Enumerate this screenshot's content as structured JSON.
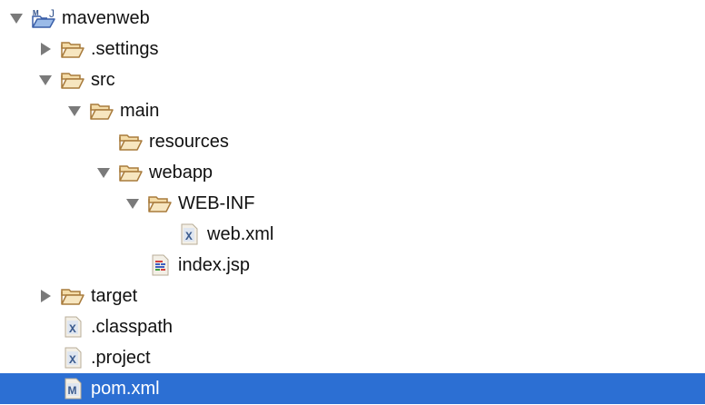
{
  "tree": [
    {
      "label": "mavenweb",
      "depth": 0,
      "toggle": "expanded",
      "icon": "maven-project-icon"
    },
    {
      "label": ".settings",
      "depth": 1,
      "toggle": "collapsed",
      "icon": "folder-icon"
    },
    {
      "label": "src",
      "depth": 1,
      "toggle": "expanded",
      "icon": "folder-icon"
    },
    {
      "label": "main",
      "depth": 2,
      "toggle": "expanded",
      "icon": "folder-icon"
    },
    {
      "label": "resources",
      "depth": 3,
      "toggle": "none",
      "icon": "folder-icon"
    },
    {
      "label": "webapp",
      "depth": 3,
      "toggle": "expanded",
      "icon": "folder-icon"
    },
    {
      "label": "WEB-INF",
      "depth": 4,
      "toggle": "expanded",
      "icon": "folder-icon"
    },
    {
      "label": "web.xml",
      "depth": 5,
      "toggle": "none",
      "icon": "xml-file-icon"
    },
    {
      "label": "index.jsp",
      "depth": 4,
      "toggle": "none",
      "icon": "jsp-file-icon"
    },
    {
      "label": "target",
      "depth": 1,
      "toggle": "collapsed",
      "icon": "folder-icon"
    },
    {
      "label": ".classpath",
      "depth": 1,
      "toggle": "none",
      "icon": "xml-file-icon"
    },
    {
      "label": ".project",
      "depth": 1,
      "toggle": "none",
      "icon": "xml-file-icon"
    },
    {
      "label": "pom.xml",
      "depth": 1,
      "toggle": "none",
      "icon": "maven-pom-icon",
      "selected": true
    }
  ],
  "colors": {
    "selection": "#2c6fd3",
    "arrow": "#7a7a7a",
    "folder": "#c9a46a"
  }
}
